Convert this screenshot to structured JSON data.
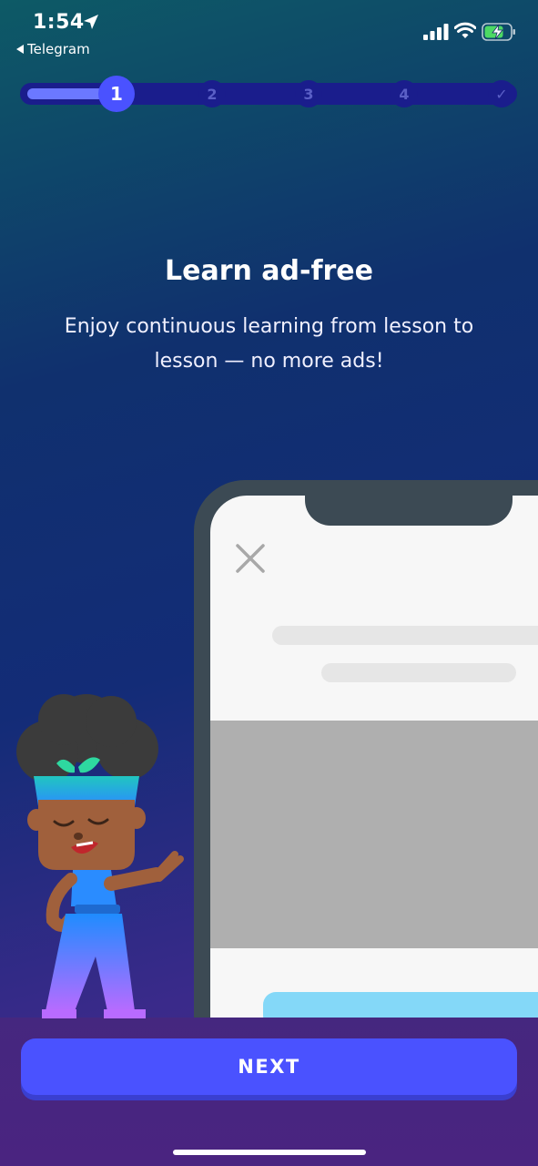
{
  "status_bar": {
    "time": "1:54",
    "back_app": "Telegram"
  },
  "stepper": {
    "steps": [
      "1",
      "2",
      "3",
      "4",
      "✓"
    ],
    "active_step": 1
  },
  "content": {
    "title": "Learn ad-free",
    "subtitle": "Enjoy continuous learning from lesson to lesson — no more ads!"
  },
  "actions": {
    "next_label": "NEXT"
  },
  "icons": {
    "location": "location-arrow-icon",
    "signal": "cellular-signal-icon",
    "wifi": "wifi-icon",
    "battery": "battery-charging-icon",
    "close": "close-icon",
    "check": "checkmark-icon"
  },
  "colors": {
    "accent": "#4a52ff",
    "track": "#1a1d8c",
    "battery_fill": "#4cd964"
  }
}
